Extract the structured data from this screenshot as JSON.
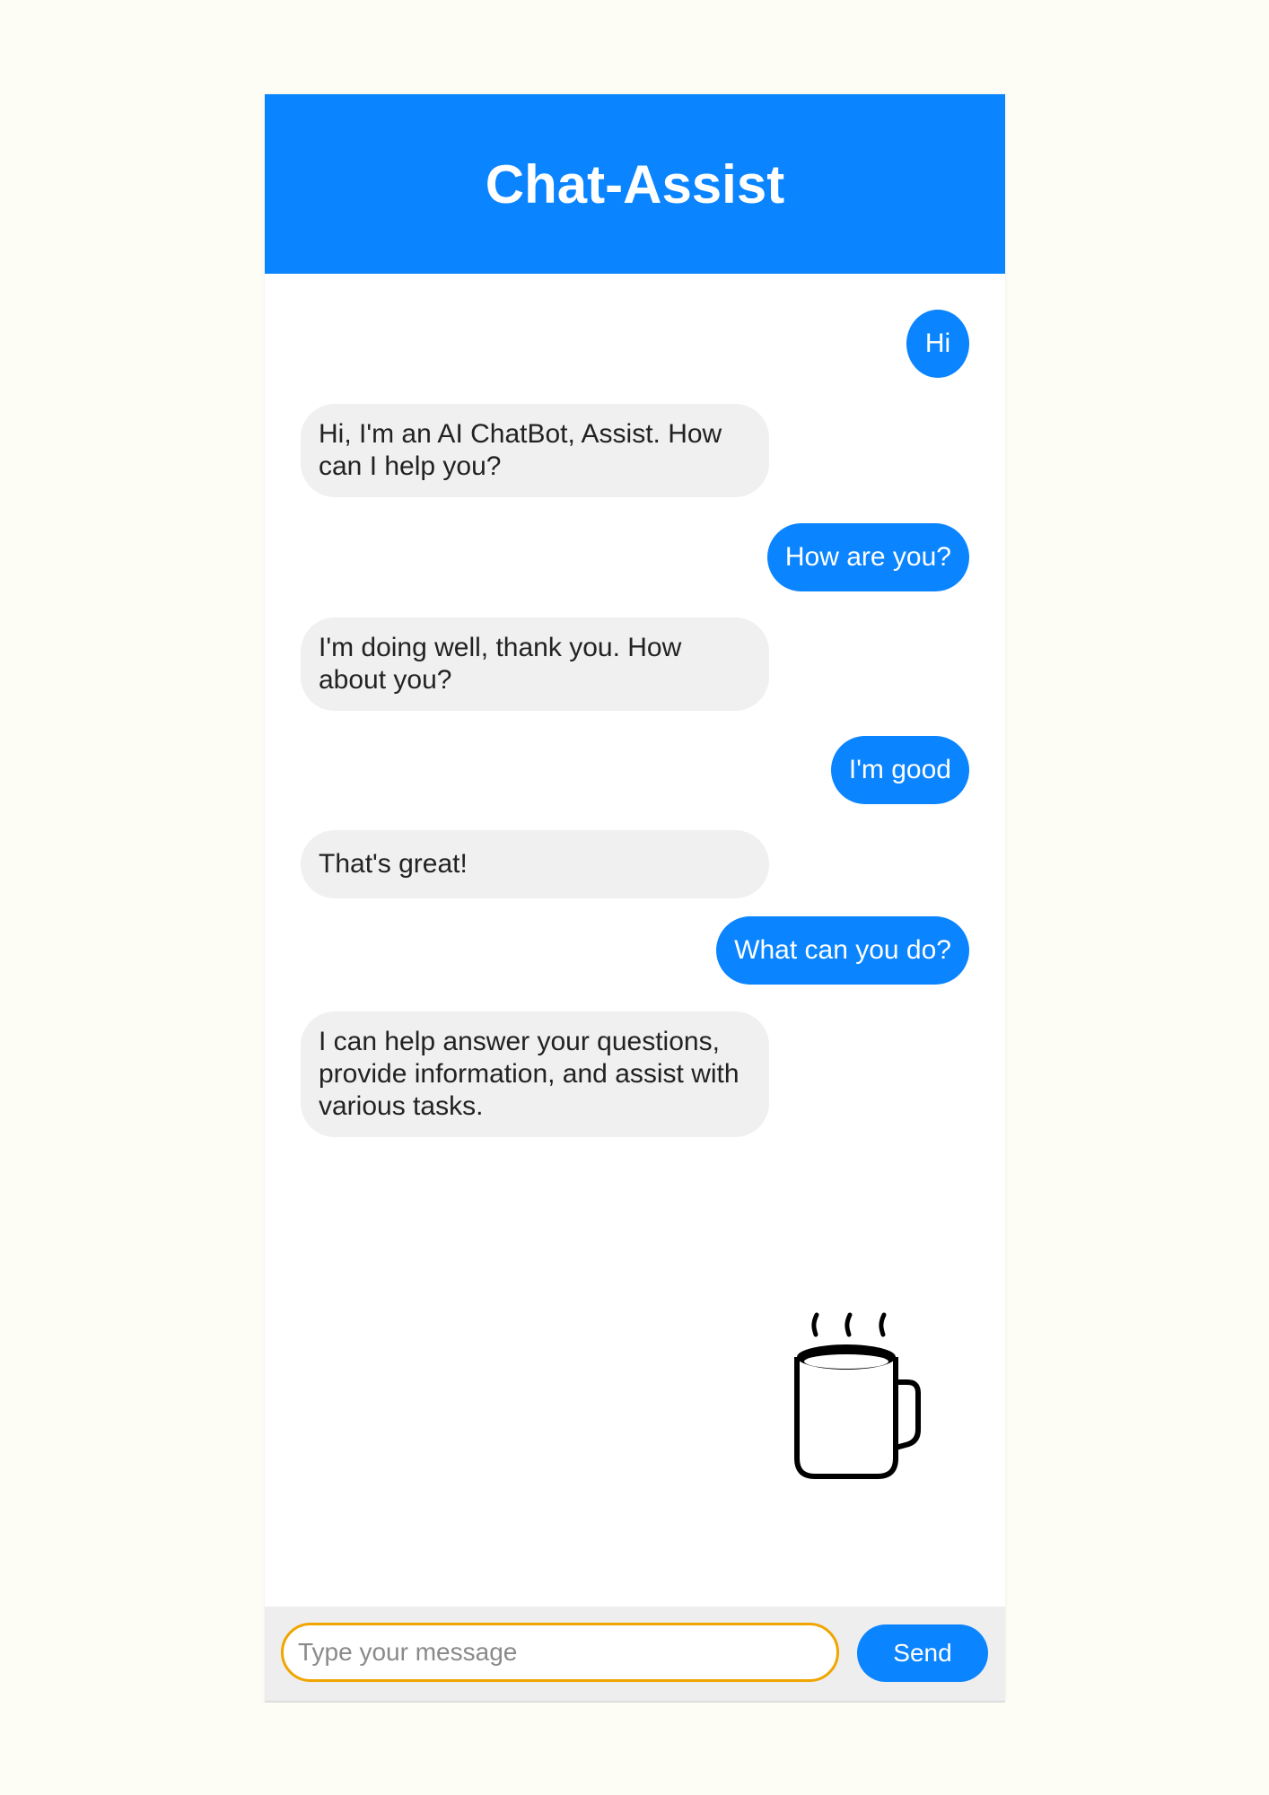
{
  "header": {
    "title": "Chat-Assist"
  },
  "messages": [
    {
      "sender": "user",
      "text": "Hi"
    },
    {
      "sender": "bot",
      "text": "Hi, I'm an AI ChatBot, Assist. How can I help you?"
    },
    {
      "sender": "user",
      "text": "How are you?"
    },
    {
      "sender": "bot",
      "text": "I'm doing well, thank you. How about you?"
    },
    {
      "sender": "user",
      "text": "I'm good"
    },
    {
      "sender": "bot",
      "text": "That's great!"
    },
    {
      "sender": "user",
      "text": "What can you do?"
    },
    {
      "sender": "bot",
      "text": "I can help answer your questions, provide information, and assist with various tasks."
    }
  ],
  "decoration": {
    "icon": "coffee-mug-icon"
  },
  "composer": {
    "value": "",
    "placeholder": "Type your message",
    "send_label": "Send"
  },
  "colors": {
    "accent": "#0a84ff",
    "bot_bubble": "#f0f0f0",
    "input_border": "#f0a500",
    "page_background": "#fdfdf6"
  }
}
